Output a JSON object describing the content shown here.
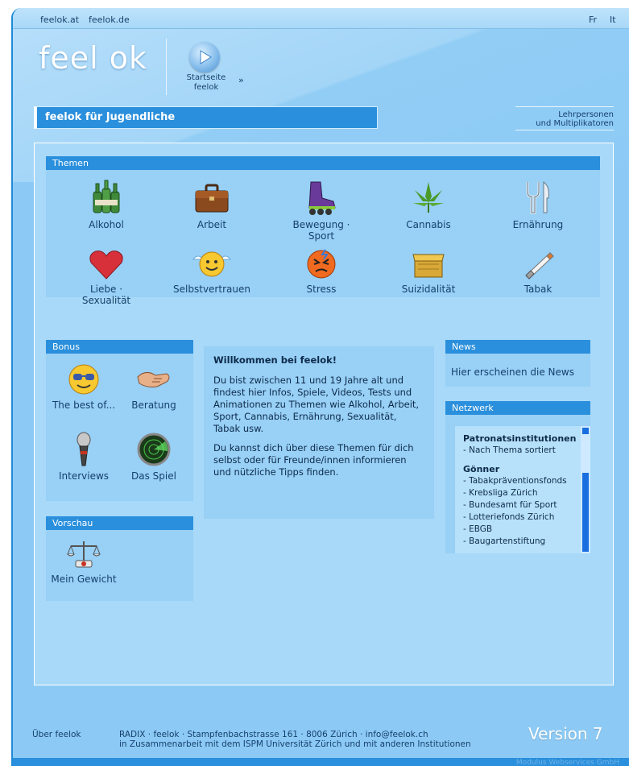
{
  "topbar": {
    "link_at": "feelok.at",
    "link_de": "feelok.de",
    "lang_fr": "Fr",
    "lang_it": "It"
  },
  "header": {
    "logo": "feel ok",
    "start_label_1": "Startseite",
    "start_label_2": "feelok",
    "start_arrow": "»",
    "jugend_title": "feelok für Jugendliche",
    "lehr_line1": "Lehrpersonen",
    "lehr_line2": "und Multiplikatoren"
  },
  "themen": {
    "heading": "Themen",
    "items": [
      {
        "label": "Alkohol",
        "icon": "bottles-icon"
      },
      {
        "label": "Arbeit",
        "icon": "briefcase-icon"
      },
      {
        "label": "Bewegung · Sport",
        "icon": "inline-skate-icon"
      },
      {
        "label": "Cannabis",
        "icon": "cannabis-leaf-icon"
      },
      {
        "label": "Ernährung",
        "icon": "cutlery-icon"
      },
      {
        "label": "Liebe · Sexualität",
        "icon": "heart-icon"
      },
      {
        "label": "Selbstvertrauen",
        "icon": "winged-smiley-icon"
      },
      {
        "label": "Stress",
        "icon": "stressed-face-icon"
      },
      {
        "label": "Suizidalität",
        "icon": "box-icon"
      },
      {
        "label": "Tabak",
        "icon": "cigarette-icon"
      }
    ]
  },
  "bonus": {
    "heading": "Bonus",
    "items": [
      {
        "label": "The best of...",
        "icon": "sunglasses-smiley-icon"
      },
      {
        "label": "Beratung",
        "icon": "handshake-icon"
      },
      {
        "label": "Interviews",
        "icon": "microphone-icon"
      },
      {
        "label": "Das Spiel",
        "icon": "radar-icon"
      }
    ]
  },
  "vorschau": {
    "heading": "Vorschau",
    "items": [
      {
        "label": "Mein Gewicht",
        "icon": "scale-icon"
      }
    ]
  },
  "welcome": {
    "title": "Willkommen bei feelok!",
    "para1": "Du bist zwischen 11 und 19 Jahre alt und findest hier Infos, Spiele, Videos, Tests und Animationen zu Themen wie Alkohol, Arbeit, Sport, Cannabis, Ernährung, Sexualität, Tabak usw.",
    "para2": "Du kannst dich über diese Themen für dich selbst oder für Freunde/innen informieren und nützliche Tipps finden."
  },
  "news": {
    "heading": "News",
    "text": "Hier erscheinen die News"
  },
  "netzwerk": {
    "heading": "Netzwerk",
    "group1": "Patronatsinstitutionen",
    "group1_items": [
      "- Nach Thema sortiert"
    ],
    "group2": "Gönner",
    "group2_items": [
      "- Tabakpräventionsfonds",
      "- Krebsliga Zürich",
      "- Bundesamt für Sport",
      "- Lotteriefonds Zürich",
      "- EBGB",
      "- Baugartenstiftung"
    ]
  },
  "footer": {
    "about": "Über feelok",
    "address_line1": "RADIX · feelok · Stampfenbachstrasse 161 · 8006 Zürich · info@feelok.ch",
    "address_line2": "in Zusammenarbeit mit dem ISPM Universität Zürich und mit anderen Institutionen",
    "version": "Version 7",
    "credit": "Modulus Webservices GmbH"
  }
}
